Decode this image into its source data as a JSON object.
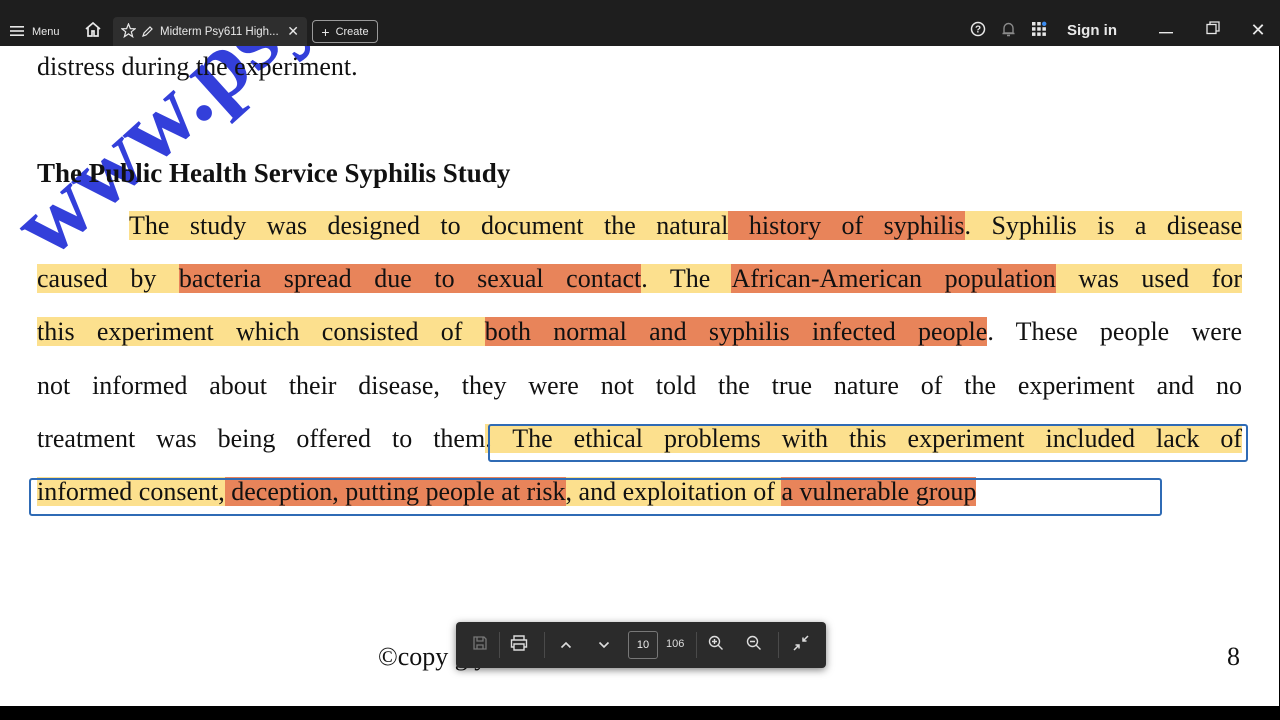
{
  "topbar": {
    "menu_label": "Menu",
    "tab_title": "Midterm Psy611 High...",
    "create_label": "Create",
    "signin_label": "Sign in"
  },
  "document": {
    "prev_line": "distress during the experiment.",
    "heading": "The Public Health Service Syphilis Study",
    "paragraph": {
      "l1_a": "The study was designed to document the natural",
      "l1_b": " history of syphilis",
      "l1_c": ". Syphilis is a disease",
      "l2_a": "caused by ",
      "l2_b": "bacteria spread due to sexual contact",
      "l2_c": ". The ",
      "l2_d": "African-American population",
      "l2_e": " was used for",
      "l3_a": "this experiment which consisted of ",
      "l3_b": "both normal and syphilis infected people",
      "l3_c": ". These people were",
      "l4": "not informed about their disease, they were not told the true nature of the experiment and no",
      "l5_a": "treatment was being offered to them",
      "l5_b": ". The ethical problems with this experiment included lack of",
      "l6_a": "informed consent,",
      "l6_b": " deception, putting people at risk",
      "l6_c": ", and exploitation of ",
      "l6_d": "a vulnerable group"
    },
    "watermark": "www.psyc",
    "footer_text": "©copy         g                              y       kistan",
    "page_number": "8"
  },
  "viewer_toolbar": {
    "current_page": "10",
    "total_pages": "106"
  },
  "colors": {
    "highlight_yellow": "#fce08e",
    "highlight_orange": "#e8845a",
    "selection_border": "#2f6bb5"
  }
}
